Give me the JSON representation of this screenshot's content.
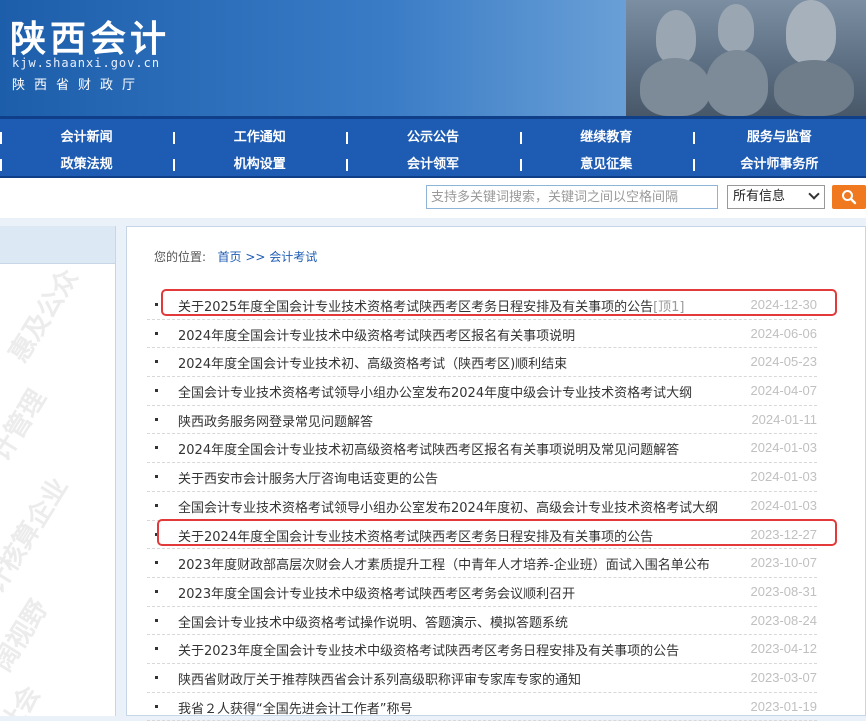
{
  "header": {
    "title": "陕西会计",
    "url": "kjw.shaanxi.gov.cn",
    "dept": "陕西省财政厅"
  },
  "nav": {
    "row1": [
      "会计新闻",
      "工作通知",
      "公示公告",
      "继续教育",
      "服务与监督"
    ],
    "row2": [
      "政策法规",
      "机构设置",
      "会计领军",
      "意见征集",
      "会计师事务所"
    ]
  },
  "search": {
    "placeholder": "支持多关键词搜索，关键词之间以空格间隔",
    "scope": "所有信息"
  },
  "left": {
    "watermarks": [
      "惠及公众",
      "计管理",
      "计核算企业",
      "阔视野",
      "社会"
    ]
  },
  "breadcrumb": {
    "label": "您的位置:",
    "home": "首页",
    "sep": ">>",
    "current": "会计考试"
  },
  "articles": [
    {
      "title": "关于2025年度全国会计专业技术资格考试陕西考区考务日程安排及有关事项的公告",
      "tag": "[顶1]",
      "date": "2024-12-30"
    },
    {
      "title": "2024年度全国会计专业技术中级资格考试陕西考区报名有关事项说明",
      "tag": "",
      "date": "2024-06-06"
    },
    {
      "title": "2024年度全国会计专业技术初、高级资格考试（陕西考区)顺利结束",
      "tag": "",
      "date": "2024-05-23"
    },
    {
      "title": "全国会计专业技术资格考试领导小组办公室发布2024年度中级会计专业技术资格考试大纲",
      "tag": "",
      "date": "2024-04-07"
    },
    {
      "title": "陕西政务服务网登录常见问题解答",
      "tag": "",
      "date": "2024-01-11"
    },
    {
      "title": "2024年度全国会计专业技术初高级资格考试陕西考区报名有关事项说明及常见问题解答",
      "tag": "",
      "date": "2024-01-03"
    },
    {
      "title": "关于西安市会计服务大厅咨询电话变更的公告",
      "tag": "",
      "date": "2024-01-03"
    },
    {
      "title": "全国会计专业技术资格考试领导小组办公室发布2024年度初、高级会计专业技术资格考试大纲",
      "tag": "",
      "date": "2024-01-03"
    },
    {
      "title": "关于2024年度全国会计专业技术资格考试陕西考区考务日程安排及有关事项的公告",
      "tag": "",
      "date": "2023-12-27"
    },
    {
      "title": "2023年度财政部高层次财会人才素质提升工程（中青年人才培养-企业班）面试入围名单公布",
      "tag": "",
      "date": "2023-10-07"
    },
    {
      "title": "2023年度全国会计专业技术中级资格考试陕西考区考务会议顺利召开",
      "tag": "",
      "date": "2023-08-31"
    },
    {
      "title": "全国会计专业技术中级资格考试操作说明、答题演示、模拟答题系统",
      "tag": "",
      "date": "2023-08-24"
    },
    {
      "title": "关于2023年度全国会计专业技术中级资格考试陕西考区考务日程安排及有关事项的公告",
      "tag": "",
      "date": "2023-04-12"
    },
    {
      "title": "陕西省财政厅关于推荐陕西省会计系列高级职称评审专家库专家的通知",
      "tag": "",
      "date": "2023-03-07"
    },
    {
      "title": "我省２人获得“全国先进会计工作者”称号",
      "tag": "",
      "date": "2023-01-19"
    }
  ],
  "colors": {
    "nav": "#1e5cb3",
    "highlight": "#e23a3a",
    "search_button": "#f0781e"
  }
}
